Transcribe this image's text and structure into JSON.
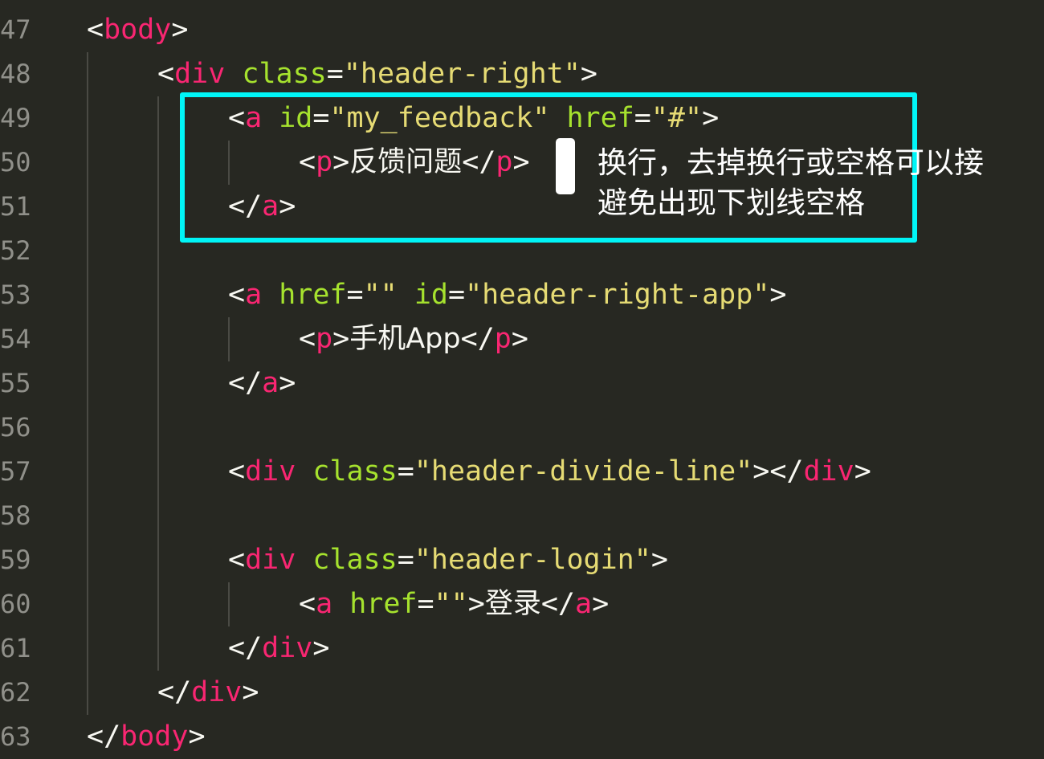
{
  "editor": {
    "theme_colors": {
      "background": "#272822",
      "tag": "#f92672",
      "attribute": "#a6e22e",
      "string": "#e6db74",
      "punctuation": "#f8f8f2",
      "line_number": "#90908a",
      "highlight_box": "#00f5f7"
    },
    "lines": [
      {
        "num": "47",
        "tokens": [
          [
            "<",
            "p"
          ],
          [
            "body",
            "t"
          ],
          [
            ">",
            "p"
          ]
        ]
      },
      {
        "num": "48",
        "tokens": [
          [
            "<",
            "p"
          ],
          [
            "div",
            "t"
          ],
          [
            " ",
            "p"
          ],
          [
            "class",
            "a"
          ],
          [
            "=",
            "p"
          ],
          [
            "\"header-right\"",
            "s"
          ],
          [
            ">",
            "p"
          ]
        ]
      },
      {
        "num": "49",
        "tokens": [
          [
            "<",
            "p"
          ],
          [
            "a",
            "t"
          ],
          [
            " ",
            "p"
          ],
          [
            "id",
            "a"
          ],
          [
            "=",
            "p"
          ],
          [
            "\"my_feedback\"",
            "s"
          ],
          [
            " ",
            "p"
          ],
          [
            "href",
            "a"
          ],
          [
            "=",
            "p"
          ],
          [
            "\"#\"",
            "s"
          ],
          [
            ">",
            "p"
          ]
        ]
      },
      {
        "num": "50",
        "tokens": [
          [
            "<",
            "p"
          ],
          [
            "p",
            "t"
          ],
          [
            ">",
            "p"
          ],
          [
            "反馈问题",
            "x"
          ],
          [
            "</",
            "p"
          ],
          [
            "p",
            "t"
          ],
          [
            ">",
            "p"
          ]
        ]
      },
      {
        "num": "51",
        "tokens": [
          [
            "</",
            "p"
          ],
          [
            "a",
            "t"
          ],
          [
            ">",
            "p"
          ]
        ]
      },
      {
        "num": "52",
        "tokens": []
      },
      {
        "num": "53",
        "tokens": [
          [
            "<",
            "p"
          ],
          [
            "a",
            "t"
          ],
          [
            " ",
            "p"
          ],
          [
            "href",
            "a"
          ],
          [
            "=",
            "p"
          ],
          [
            "\"\"",
            "s"
          ],
          [
            " ",
            "p"
          ],
          [
            "id",
            "a"
          ],
          [
            "=",
            "p"
          ],
          [
            "\"header-right-app\"",
            "s"
          ],
          [
            ">",
            "p"
          ]
        ]
      },
      {
        "num": "54",
        "tokens": [
          [
            "<",
            "p"
          ],
          [
            "p",
            "t"
          ],
          [
            ">",
            "p"
          ],
          [
            "手机App",
            "x"
          ],
          [
            "</",
            "p"
          ],
          [
            "p",
            "t"
          ],
          [
            ">",
            "p"
          ]
        ]
      },
      {
        "num": "55",
        "tokens": [
          [
            "</",
            "p"
          ],
          [
            "a",
            "t"
          ],
          [
            ">",
            "p"
          ]
        ]
      },
      {
        "num": "56",
        "tokens": []
      },
      {
        "num": "57",
        "tokens": [
          [
            "<",
            "p"
          ],
          [
            "div",
            "t"
          ],
          [
            " ",
            "p"
          ],
          [
            "class",
            "a"
          ],
          [
            "=",
            "p"
          ],
          [
            "\"header-divide-line\"",
            "s"
          ],
          [
            "></",
            "p"
          ],
          [
            "div",
            "t"
          ],
          [
            ">",
            "p"
          ]
        ]
      },
      {
        "num": "58",
        "tokens": []
      },
      {
        "num": "59",
        "tokens": [
          [
            "<",
            "p"
          ],
          [
            "div",
            "t"
          ],
          [
            " ",
            "p"
          ],
          [
            "class",
            "a"
          ],
          [
            "=",
            "p"
          ],
          [
            "\"header-login\"",
            "s"
          ],
          [
            ">",
            "p"
          ]
        ]
      },
      {
        "num": "60",
        "tokens": [
          [
            "<",
            "p"
          ],
          [
            "a",
            "t"
          ],
          [
            " ",
            "p"
          ],
          [
            "href",
            "a"
          ],
          [
            "=",
            "p"
          ],
          [
            "\"\"",
            "s"
          ],
          [
            ">",
            "p"
          ],
          [
            "登录",
            "x"
          ],
          [
            "</",
            "p"
          ],
          [
            "a",
            "t"
          ],
          [
            ">",
            "p"
          ]
        ]
      },
      {
        "num": "61",
        "tokens": [
          [
            "</",
            "p"
          ],
          [
            "div",
            "t"
          ],
          [
            ">",
            "p"
          ]
        ]
      },
      {
        "num": "62",
        "tokens": [
          [
            "</",
            "p"
          ],
          [
            "div",
            "t"
          ],
          [
            ">",
            "p"
          ]
        ]
      },
      {
        "num": "63",
        "tokens": [
          [
            "</",
            "p"
          ],
          [
            "body",
            "t"
          ],
          [
            ">",
            "p"
          ]
        ]
      }
    ]
  },
  "annotation": {
    "line1": "换行，去掉换行或空格可以接",
    "line2": "避免出现下划线空格"
  }
}
